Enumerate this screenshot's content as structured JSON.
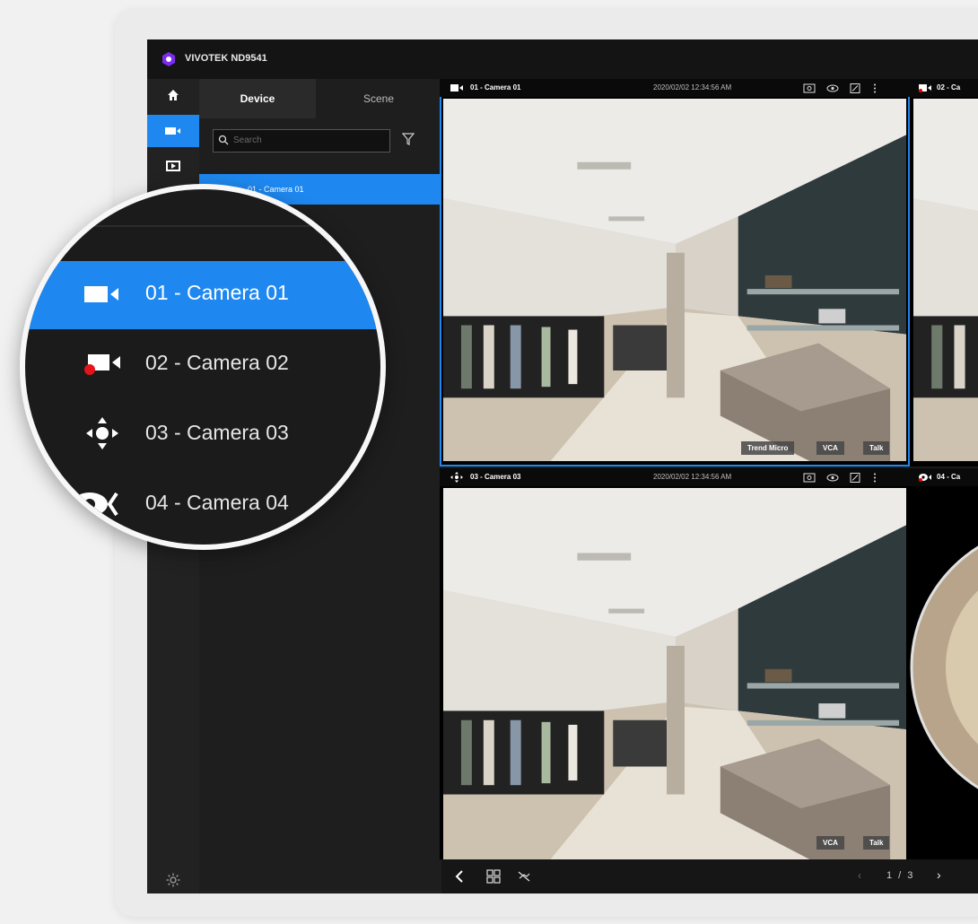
{
  "app": {
    "title": "VIVOTEK ND9541"
  },
  "sidebar": {
    "tabs": [
      {
        "label": "Device"
      },
      {
        "label": "Scene"
      }
    ],
    "search_placeholder": "Search",
    "cameras": [
      {
        "label": "01 - Camera 01",
        "icon": "camera-icon",
        "selected": true
      },
      {
        "label": "02 - Camera 02",
        "icon": "camera-recording-icon"
      },
      {
        "label": "03 - Camera 03",
        "icon": "ptz-camera-icon"
      },
      {
        "label": "04 - Camera 04",
        "icon": "fisheye-camera-icon"
      }
    ]
  },
  "tiles": [
    {
      "name": "01 - Camera 01",
      "timestamp": "2020/02/02  12:34:56  AM",
      "chips": [
        "Trend Micro",
        "VCA",
        "Talk"
      ]
    },
    {
      "name": "02 - Ca"
    },
    {
      "name": "03 - Camera 03",
      "timestamp": "2020/02/02  12:34:56  AM",
      "chips": [
        "VCA",
        "Talk"
      ]
    },
    {
      "name": "04 - Ca"
    }
  ],
  "bottombar": {
    "page": "1 / 3"
  },
  "colors": {
    "accent": "#1e88f0",
    "logo": "#7b2cf0",
    "background": "#1a1a1a"
  }
}
